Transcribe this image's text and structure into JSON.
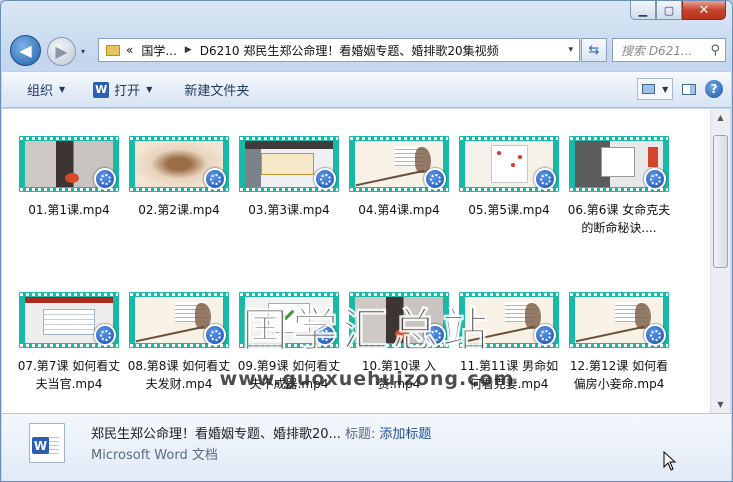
{
  "window": {
    "caption": {
      "minimize": "▁",
      "maximize": "▢",
      "close": "✕"
    }
  },
  "nav": {
    "back_icon": "◀",
    "forward_icon": "▶",
    "history_icon": "▾"
  },
  "address": {
    "segments": [
      "«",
      "国学...",
      "D6210 郑民生郑公命理！看婚姻专题、婚排歌20集视频"
    ],
    "dropdown_icon": "▾",
    "refresh_icon": "⇆"
  },
  "search": {
    "placeholder": "搜索 D621...",
    "icon": "⚲"
  },
  "toolbar": {
    "organize": "组织",
    "open": "打开",
    "new_folder": "新建文件夹",
    "word_glyph": "W",
    "caret": "▼",
    "help": "?"
  },
  "files": [
    {
      "name": "01.第1课.mp4",
      "frame": "woman"
    },
    {
      "name": "02.第2课.mp4",
      "frame": "ink"
    },
    {
      "name": "03.第3课.mp4",
      "frame": "doc"
    },
    {
      "name": "04.第4课.mp4",
      "frame": "paint"
    },
    {
      "name": "05.第5课.mp4",
      "frame": "web"
    },
    {
      "name": "06.第6课 女命克夫的断命秘诀....",
      "frame": "app"
    },
    {
      "name": "07.第7课 如何看丈夫当官.mp4",
      "frame": "tab"
    },
    {
      "name": "08.第8课 如何看丈夫发财.mp4",
      "frame": "paint"
    },
    {
      "name": "09.第9课 如何看丈夫不成器.mp4",
      "frame": "check"
    },
    {
      "name": "10.第10课 入赘.mp4",
      "frame": "woman"
    },
    {
      "name": "11.第11课 男命如何看克妻.mp4",
      "frame": "paint"
    },
    {
      "name": "12.第12课 如何看偏房小妾命.mp4",
      "frame": "paint"
    }
  ],
  "watermark": {
    "title": "国学汇总站",
    "url": "www.guoxuehuizong.com"
  },
  "scrollbar": {
    "up": "▲",
    "down": "▼"
  },
  "details": {
    "name": "郑民生郑公命理！看婚姻专题、婚排歌20...",
    "tag_label": "标题:",
    "tag_value": "添加标题",
    "type": "Microsoft Word 文档",
    "word_glyph": "W"
  }
}
